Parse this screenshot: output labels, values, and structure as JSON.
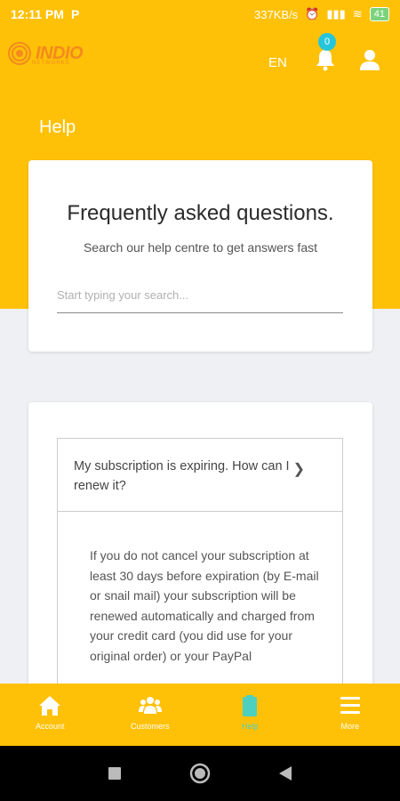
{
  "status_bar": {
    "time": "12:11 PM",
    "app_indicator": "P",
    "net_speed": "337KB/s",
    "battery": "41"
  },
  "header": {
    "logo_text": "INDIO",
    "logo_subtext": "NETWORKS",
    "language": "EN",
    "notification_count": "0",
    "page_title": "Help"
  },
  "faq": {
    "title": "Frequently asked questions.",
    "subtitle": "Search our help centre to get answers fast",
    "search_placeholder": "Start typing your search...",
    "search_value": ""
  },
  "questions": [
    {
      "question": "My subscription is expiring. How can I renew it?",
      "answer": "If you do not cancel your subscription at least 30 days before expiration (by E-mail or snail mail) your subscription will be renewed automatically and charged from your credit card (you did use for your original order) or your PayPal",
      "expanded": true
    }
  ],
  "bottom_nav": {
    "items": [
      {
        "label": "Account",
        "icon": "home-icon",
        "active": false
      },
      {
        "label": "Customers",
        "icon": "users-icon",
        "active": false
      },
      {
        "label": "Help",
        "icon": "clipboard-icon",
        "active": true
      },
      {
        "label": "More",
        "icon": "menu-icon",
        "active": false
      }
    ]
  },
  "colors": {
    "brand": "#ffc107",
    "accent": "#26c6da",
    "logo": "#f48a1e"
  }
}
